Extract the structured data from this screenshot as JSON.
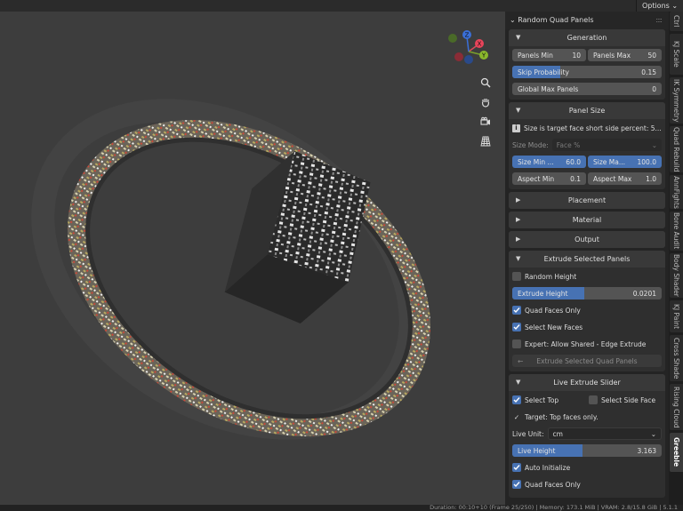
{
  "topbar": {
    "options_label": "Options"
  },
  "panel": {
    "title": "Random Quad Panels",
    "generation": {
      "title": "Generation",
      "panels_min_label": "Panels Min",
      "panels_min_value": "10",
      "panels_max_label": "Panels Max",
      "panels_max_value": "50",
      "skip_label": "Skip Probability",
      "skip_value": "0.15",
      "global_max_label": "Global Max Panels",
      "global_max_value": "0"
    },
    "panel_size": {
      "title": "Panel Size",
      "info": "Size is target face short side percent: 5...",
      "size_mode_label": "Size Mode:",
      "size_mode_value": "Face %",
      "size_min_label": "Size Min ...",
      "size_min_value": "60.0",
      "size_max_label": "Size Ma...",
      "size_max_value": "100.0",
      "aspect_min_label": "Aspect Min",
      "aspect_min_value": "0.1",
      "aspect_max_label": "Aspect Max",
      "aspect_max_value": "1.0"
    },
    "placement": {
      "title": "Placement"
    },
    "material": {
      "title": "Material"
    },
    "output": {
      "title": "Output"
    },
    "extrude": {
      "title": "Extrude Selected Panels",
      "random_height_label": "Random Height",
      "extrude_height_label": "Extrude Height",
      "extrude_height_value": "0.0201",
      "extrude_height_fraction": 0.48,
      "quad_faces_label": "Quad Faces Only",
      "select_new_label": "Select New Faces",
      "expert_label": "Expert: Allow Shared - Edge Extrude",
      "button_label": "Extrude Selected Quad Panels"
    },
    "live": {
      "title": "Live Extrude Slider",
      "select_top_label": "Select Top",
      "select_side_label": "Select Side Face",
      "target_text": "Target: Top faces only.",
      "unit_label": "Live Unit:",
      "unit_value": "cm",
      "live_height_label": "Live Height",
      "live_height_value": "3.163",
      "live_height_fraction": 0.47,
      "auto_init_label": "Auto Initialize",
      "quad_faces_label": "Quad Faces Only"
    }
  },
  "tabs": [
    "Ctrl",
    "KJ Scale",
    "IK Symmetry",
    "Quad Rebuild",
    "AnnFights",
    "Bone Audit",
    "Body Shader",
    "KJ Paint",
    "Cross Shade",
    "Rising Cloud",
    "Greeble"
  ],
  "gizmo": {
    "x": "X",
    "y": "Y",
    "z": "Z"
  },
  "status": "Duration: 00:10+10 (Frame 25/250) | Memory: 173.1 MiB | VRAM: 2.8/15.8 GiB | 5.1.1"
}
